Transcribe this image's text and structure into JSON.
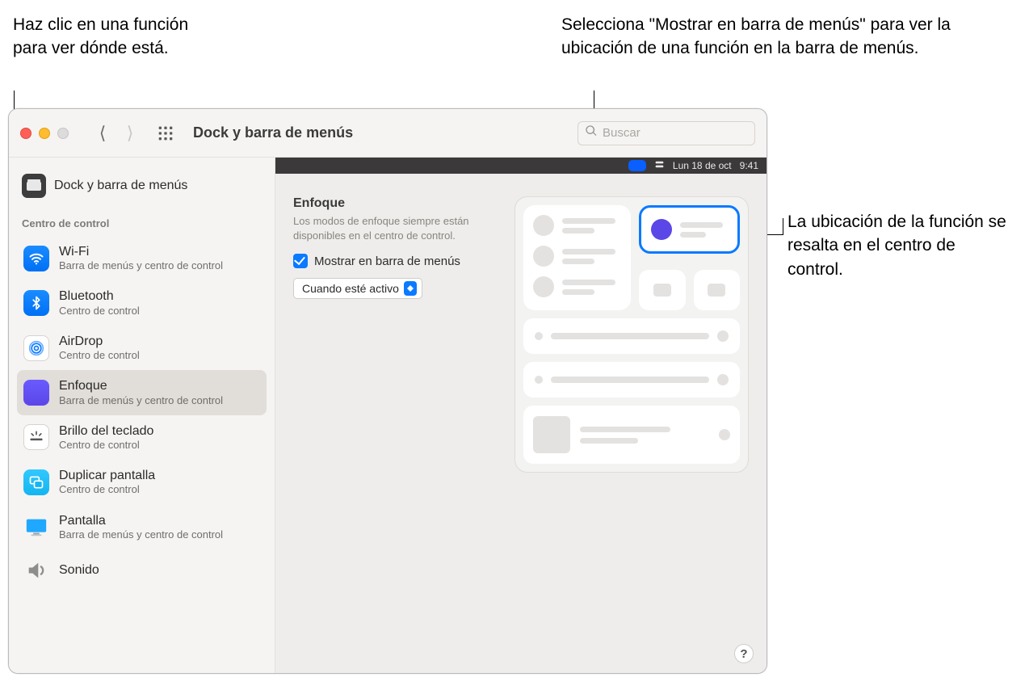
{
  "callouts": {
    "left": "Haz clic en una función para ver dónde está.",
    "topright": "Selecciona \"Mostrar en barra de menús\" para ver la ubicación de una función en la barra de menús.",
    "right": "La ubicación de la función se resalta en el centro de control."
  },
  "toolbar": {
    "title": "Dock y barra de menús",
    "search_placeholder": "Buscar"
  },
  "sidebar": {
    "header": "Dock y barra de menús",
    "section": "Centro de control",
    "items": [
      {
        "title": "Wi-Fi",
        "sub": "Barra de menús y centro de control"
      },
      {
        "title": "Bluetooth",
        "sub": "Centro de control"
      },
      {
        "title": "AirDrop",
        "sub": "Centro de control"
      },
      {
        "title": "Enfoque",
        "sub": "Barra de menús y centro de control"
      },
      {
        "title": "Brillo del teclado",
        "sub": "Centro de control"
      },
      {
        "title": "Duplicar pantalla",
        "sub": "Centro de control"
      },
      {
        "title": "Pantalla",
        "sub": "Barra de menús y centro de control"
      },
      {
        "title": "Sonido",
        "sub": ""
      }
    ]
  },
  "pane": {
    "title": "Enfoque",
    "desc": "Los modos de enfoque siempre están disponibles en el centro de control.",
    "checkbox_label": "Mostrar en barra de menús",
    "select_value": "Cuando esté activo"
  },
  "menubar": {
    "date": "Lun 18 de oct",
    "time": "9:41"
  },
  "help": "?"
}
